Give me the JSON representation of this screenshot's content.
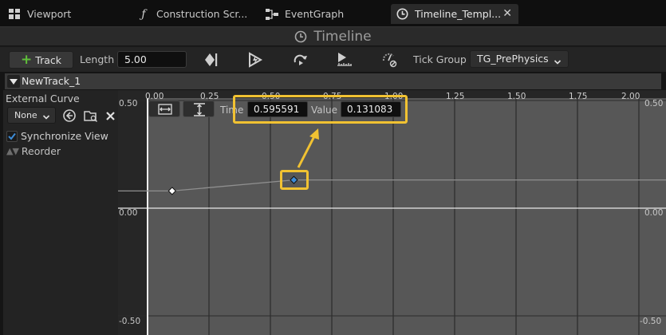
{
  "tabs": [
    {
      "label": "Viewport",
      "icon": "grid-icon"
    },
    {
      "label": "Construction Scr...",
      "icon": "function-icon"
    },
    {
      "label": "EventGraph",
      "icon": "graph-icon"
    },
    {
      "label": "Timeline_Templ...",
      "icon": "clock-icon",
      "active": true
    }
  ],
  "panel_title": "Timeline",
  "toolbar": {
    "track_label": "Track",
    "length_label": "Length",
    "length_value": "5.00",
    "tick_group_label": "Tick Group",
    "tick_group_value": "TG_PrePhysics"
  },
  "track": {
    "name": "NewTrack_1"
  },
  "left_panel": {
    "external_curve_label": "External Curve",
    "curve_select": "None",
    "sync_view_label": "Synchronize View",
    "sync_view_checked": true,
    "reorder_label": "Reorder"
  },
  "graph": {
    "x_ticks": [
      "0.00",
      "0.25",
      "0.50",
      "0.75",
      "1.00",
      "1.25",
      "1.50",
      "1.75",
      "2.00"
    ],
    "y_ticks_left": [
      "0.50",
      "0.00",
      "-0.50"
    ],
    "y_ticks_right": [
      "0.50",
      "0.00",
      "-0.50"
    ],
    "time_label": "Time",
    "time_value": "0.595591",
    "value_label": "Value",
    "value_value": "0.131083",
    "keys": [
      {
        "time": 0.1,
        "value": 0.08,
        "selected": false
      },
      {
        "time": 0.595591,
        "value": 0.131083,
        "selected": true
      }
    ]
  },
  "colors": {
    "highlight": "#f1c232",
    "selected_key": "#3d8bd6",
    "track_add": "#5fbf3a"
  }
}
